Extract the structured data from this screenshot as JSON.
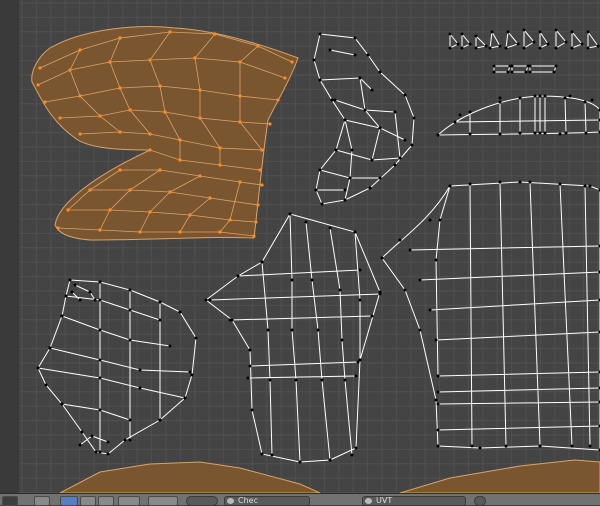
{
  "editor": "uv-image-editor",
  "viewport": {
    "background": "#444444",
    "grid_color": "#505050",
    "grid_major_color": "#4a4a4a",
    "wire_color": "#ffffff",
    "vertex_color": "#000000",
    "selected_face_color": "#7a5630",
    "selected_vertex_color": "#ff8a1f"
  },
  "header": {
    "image_selector": {
      "value": "Chec",
      "icon": "image-icon"
    },
    "uv_selector": {
      "value": "UVT",
      "icon": "uv-map-icon"
    }
  }
}
